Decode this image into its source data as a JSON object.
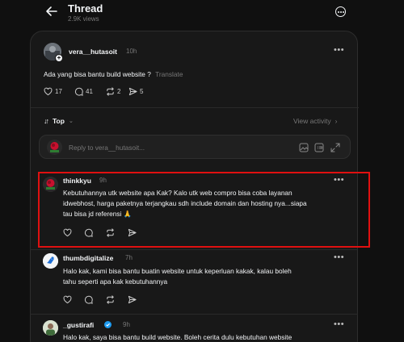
{
  "header": {
    "title": "Thread",
    "views": "2.9K views"
  },
  "post": {
    "username": "vera__hutasoit",
    "time": "10h",
    "text": "Ada yang bisa bantu build website ?",
    "translate": "Translate",
    "likes": "17",
    "comments": "41",
    "reposts": "2",
    "shares": "5"
  },
  "sort": {
    "label": "Top",
    "view_activity": "View activity"
  },
  "reply_box": {
    "placeholder": "Reply to vera__hutasoit..."
  },
  "replies": [
    {
      "username": "thinkkyu",
      "time": "9h",
      "line1": "Kebutuhannya utk website apa Kak? Kalo utk web compro bisa coba layanan",
      "line2": "idwebhost, harga paketnya terjangkau sdh include domain dan hosting nya...siapa",
      "line3": "tau bisa jd referensi 🙏"
    },
    {
      "username": "thumbdigitalize",
      "time": "7h",
      "line1": "Halo kak, kami bisa bantu buatin website untuk keperluan kakak, kalau boleh",
      "line2": "tahu seperti apa kak kebutuhannya"
    },
    {
      "username": "_gustirafi",
      "time": "9h",
      "line1": "Halo kak, saya bisa bantu build website. Boleh cerita dulu kebutuhan website"
    }
  ],
  "colors": {
    "background": "#101010",
    "card": "#181818",
    "highlight": "#e01010",
    "verified": "#1d9bf0"
  }
}
